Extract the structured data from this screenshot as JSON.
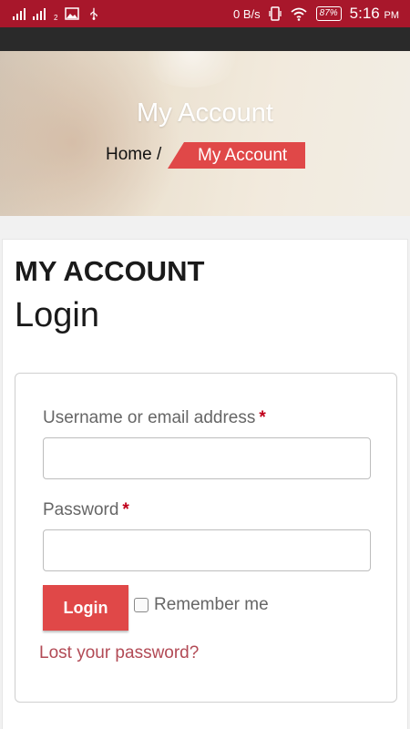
{
  "status_bar": {
    "sim_label": "2",
    "net_speed": "0 B/s",
    "battery": "87%",
    "time": "5:16",
    "ampm": "PM",
    "icons": [
      "signal-icon",
      "signal-icon",
      "image-icon",
      "usb-icon",
      "vibrate-icon",
      "wifi-icon",
      "battery-icon"
    ]
  },
  "hero": {
    "title": "My Account",
    "breadcrumb": {
      "home": "Home",
      "separator": "/",
      "current": "My Account"
    }
  },
  "content": {
    "heading": "MY ACCOUNT",
    "subheading": "Login",
    "form": {
      "username_label": "Username or email address",
      "password_label": "Password",
      "required_mark": "*",
      "username_value": "",
      "password_value": "",
      "login_button": "Login",
      "remember_label": "Remember me",
      "remember_checked": false,
      "lost_password": "Lost your password?"
    }
  },
  "colors": {
    "status_bar": "#a8172b",
    "accent": "#e04848",
    "link": "#b24a55",
    "required": "#c0001a"
  }
}
